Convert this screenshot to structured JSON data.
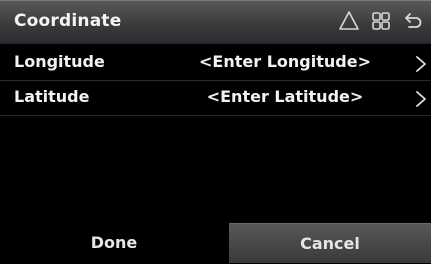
{
  "header": {
    "title": "Coordinate",
    "icons": [
      "navigation-icon",
      "grid-icon",
      "back-icon"
    ]
  },
  "rows": [
    {
      "label": "Longitude",
      "value": "<Enter Longitude>"
    },
    {
      "label": "Latitude",
      "value": "<Enter Latitude>"
    }
  ],
  "footer": {
    "done_label": "Done",
    "cancel_label": "Cancel"
  }
}
